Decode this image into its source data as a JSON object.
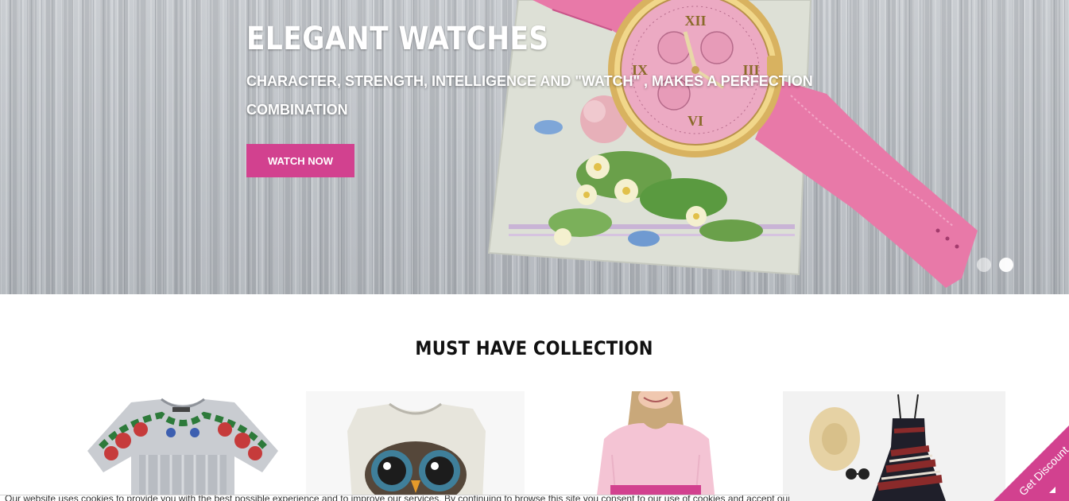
{
  "hero": {
    "title": "ELEGANT WATCHES",
    "subtitle": "CHARACTER, STRENGTH, INTELLIGENCE AND \"WATCH\" , MAKES A PERFECTION COMBINATION",
    "cta_label": "WATCH NOW",
    "slides": 2,
    "active_slide": 2
  },
  "collection": {
    "title": "MUST HAVE COLLECTION",
    "products": [
      {
        "icon": "floral-tshirt-image"
      },
      {
        "icon": "owl-print-tshirt-image"
      },
      {
        "icon": "pink-sweater-model-image"
      },
      {
        "icon": "striped-dress-hat-image"
      }
    ]
  },
  "cookie_bar": {
    "text": "Our website uses cookies to provide you with the best possible experience and to improve our services. By continuing to browse this site you consent to our use of cookies and accept our privacy policy"
  },
  "discount": {
    "label": "Get Discount"
  },
  "colors": {
    "accent": "#d2418f",
    "text_dark": "#111111",
    "hero_bg": "#b7bcc2"
  }
}
